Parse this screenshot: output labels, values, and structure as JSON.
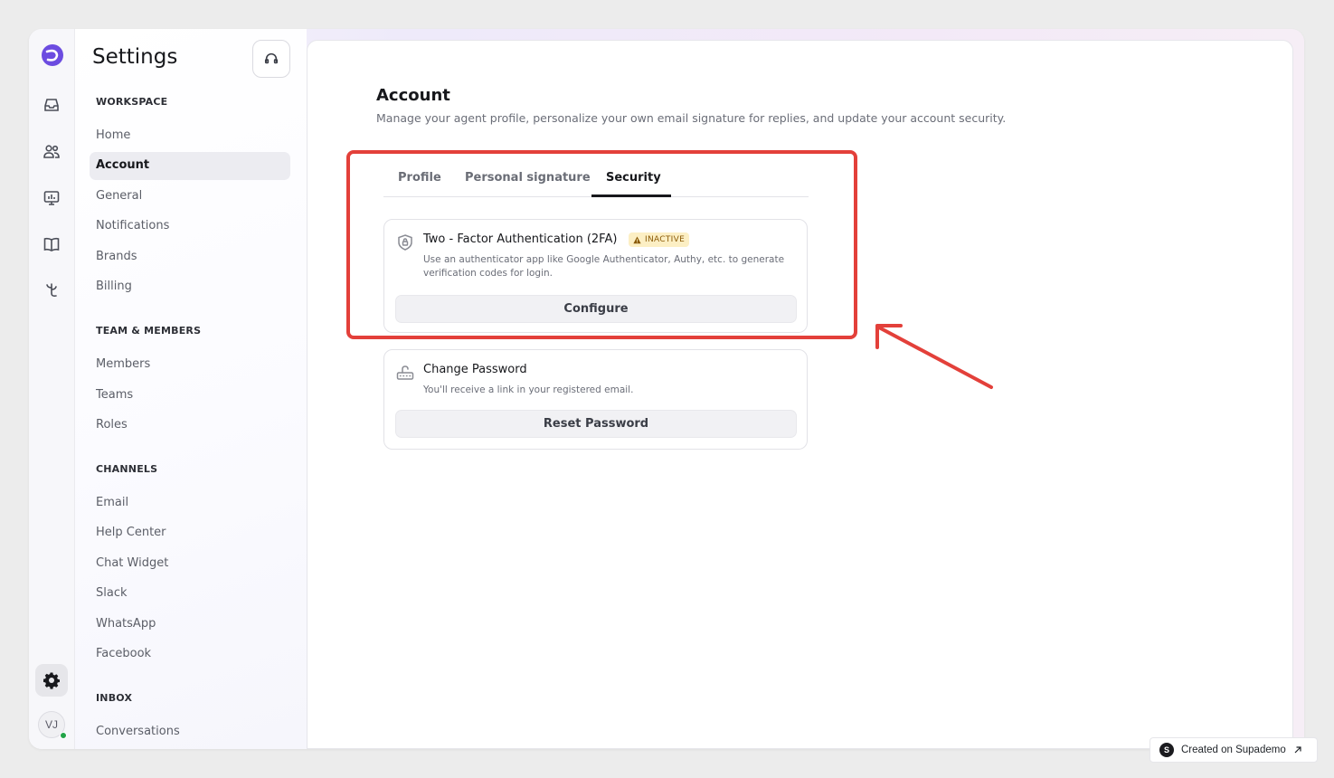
{
  "sidebar": {
    "title": "Settings",
    "sections": [
      {
        "heading": "WORKSPACE",
        "items": [
          "Home",
          "Account",
          "General",
          "Notifications",
          "Brands",
          "Billing"
        ]
      },
      {
        "heading": "TEAM & MEMBERS",
        "items": [
          "Members",
          "Teams",
          "Roles"
        ]
      },
      {
        "heading": "CHANNELS",
        "items": [
          "Email",
          "Help Center",
          "Chat Widget",
          "Slack",
          "WhatsApp",
          "Facebook"
        ]
      },
      {
        "heading": "INBOX",
        "items": [
          "Conversations"
        ]
      }
    ],
    "active_item": "Account"
  },
  "rail": {
    "icons": [
      "brand-logo-icon",
      "inbox-icon",
      "users-icon",
      "reports-icon",
      "knowledge-book-icon",
      "automation-icon",
      "settings-gear-icon"
    ],
    "avatar_initials": "VJ",
    "status_color": "#22a447"
  },
  "account": {
    "title": "Account",
    "subtitle": "Manage your agent profile, personalize your own email signature for replies, and update your account security."
  },
  "tabs": {
    "items": [
      "Profile",
      "Personal signature",
      "Security"
    ],
    "active": "Security"
  },
  "two_factor": {
    "title": "Two - Factor Authentication (2FA)",
    "badge": "INACTIVE",
    "description": "Use an authenticator app like Google Authenticator, Authy, etc. to generate verification codes for login.",
    "button": "Configure"
  },
  "change_password": {
    "title": "Change Password",
    "description": "You'll receive a link in your registered email.",
    "button": "Reset Password"
  },
  "annotation": {
    "highlight_color": "#e3403a"
  },
  "footer": {
    "label": "Created on Supademo",
    "logo_letter": "S"
  }
}
